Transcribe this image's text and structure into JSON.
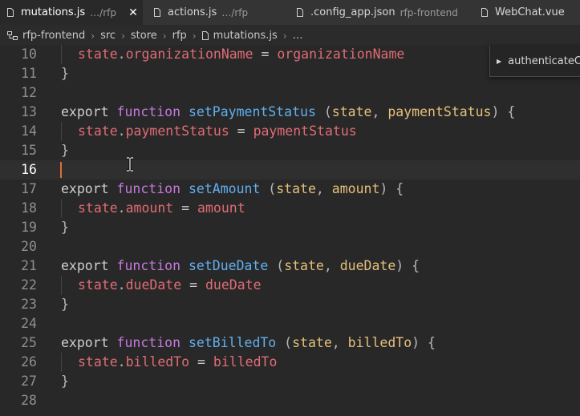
{
  "tabs": [
    {
      "name": "mutations.js",
      "desc": "…/rfp",
      "active": true,
      "close": "✕"
    },
    {
      "name": "actions.js",
      "desc": "…/rfp",
      "active": false
    },
    {
      "name": ".config_app.json",
      "desc": "rfp-frontend",
      "active": false
    },
    {
      "name": "WebChat.vue",
      "desc": "",
      "active": false
    }
  ],
  "breadcrumb": {
    "items": [
      "rfp-frontend",
      "src",
      "store",
      "rfp",
      "mutations.js",
      "…"
    ],
    "separator": "›"
  },
  "outline": {
    "item_label": "authenticateC",
    "caret": "▶"
  },
  "editor": {
    "current_line": "16",
    "lines": [
      {
        "n": "10",
        "tokens": [
          [
            "state",
            "var"
          ],
          [
            ".",
            "punc"
          ],
          [
            "organizationName",
            "var"
          ],
          [
            " = ",
            "op"
          ],
          [
            "organizationName",
            "var"
          ]
        ],
        "indent": true
      },
      {
        "n": "11",
        "tokens": [
          [
            "}",
            "punc"
          ]
        ]
      },
      {
        "n": "12",
        "tokens": []
      },
      {
        "n": "13",
        "tokens": [
          [
            "export",
            "kw-export"
          ],
          [
            " ",
            "op"
          ],
          [
            "function",
            "kw-function"
          ],
          [
            " ",
            "op"
          ],
          [
            "setPaymentStatus",
            "fn"
          ],
          [
            " (",
            "punc"
          ],
          [
            "state",
            "param"
          ],
          [
            ", ",
            "punc"
          ],
          [
            "paymentStatus",
            "param"
          ],
          [
            ") {",
            "punc"
          ]
        ]
      },
      {
        "n": "14",
        "tokens": [
          [
            "state",
            "var"
          ],
          [
            ".",
            "punc"
          ],
          [
            "paymentStatus",
            "var"
          ],
          [
            " = ",
            "op"
          ],
          [
            "paymentStatus",
            "var"
          ]
        ],
        "indent": true
      },
      {
        "n": "15",
        "tokens": [
          [
            "}",
            "punc"
          ]
        ]
      },
      {
        "n": "16",
        "tokens": []
      },
      {
        "n": "17",
        "tokens": [
          [
            "export",
            "kw-export"
          ],
          [
            " ",
            "op"
          ],
          [
            "function",
            "kw-function"
          ],
          [
            " ",
            "op"
          ],
          [
            "setAmount",
            "fn"
          ],
          [
            " (",
            "punc"
          ],
          [
            "state",
            "param"
          ],
          [
            ", ",
            "punc"
          ],
          [
            "amount",
            "param"
          ],
          [
            ") {",
            "punc"
          ]
        ]
      },
      {
        "n": "18",
        "tokens": [
          [
            "state",
            "var"
          ],
          [
            ".",
            "punc"
          ],
          [
            "amount",
            "var"
          ],
          [
            " = ",
            "op"
          ],
          [
            "amount",
            "var"
          ]
        ],
        "indent": true
      },
      {
        "n": "19",
        "tokens": [
          [
            "}",
            "punc"
          ]
        ]
      },
      {
        "n": "20",
        "tokens": []
      },
      {
        "n": "21",
        "tokens": [
          [
            "export",
            "kw-export"
          ],
          [
            " ",
            "op"
          ],
          [
            "function",
            "kw-function"
          ],
          [
            " ",
            "op"
          ],
          [
            "setDueDate",
            "fn"
          ],
          [
            " (",
            "punc"
          ],
          [
            "state",
            "param"
          ],
          [
            ", ",
            "punc"
          ],
          [
            "dueDate",
            "param"
          ],
          [
            ") {",
            "punc"
          ]
        ]
      },
      {
        "n": "22",
        "tokens": [
          [
            "state",
            "var"
          ],
          [
            ".",
            "punc"
          ],
          [
            "dueDate",
            "var"
          ],
          [
            " = ",
            "op"
          ],
          [
            "dueDate",
            "var"
          ]
        ],
        "indent": true
      },
      {
        "n": "23",
        "tokens": [
          [
            "}",
            "punc"
          ]
        ]
      },
      {
        "n": "24",
        "tokens": []
      },
      {
        "n": "25",
        "tokens": [
          [
            "export",
            "kw-export"
          ],
          [
            " ",
            "op"
          ],
          [
            "function",
            "kw-function"
          ],
          [
            " ",
            "op"
          ],
          [
            "setBilledTo",
            "fn"
          ],
          [
            " (",
            "punc"
          ],
          [
            "state",
            "param"
          ],
          [
            ", ",
            "punc"
          ],
          [
            "billedTo",
            "param"
          ],
          [
            ") {",
            "punc"
          ]
        ]
      },
      {
        "n": "26",
        "tokens": [
          [
            "state",
            "var"
          ],
          [
            ".",
            "punc"
          ],
          [
            "billedTo",
            "var"
          ],
          [
            " = ",
            "op"
          ],
          [
            "billedTo",
            "var"
          ]
        ],
        "indent": true
      },
      {
        "n": "27",
        "tokens": [
          [
            "}",
            "punc"
          ]
        ]
      },
      {
        "n": "28",
        "tokens": []
      }
    ]
  },
  "colors": {
    "background": "#282828",
    "keyword_function": "#c678dd",
    "function_name": "#61afef",
    "parameter": "#e5c07b",
    "variable": "#e06c75",
    "cursor": "#e06c3c"
  },
  "icons": {
    "tab_file": "file-icon",
    "tab_close": "close-icon",
    "breadcrumb_root": "folder-tree-icon",
    "breadcrumb_file": "file-icon",
    "outline_caret": "caret-right-icon",
    "mouse_cursor": "text-cursor-icon"
  }
}
